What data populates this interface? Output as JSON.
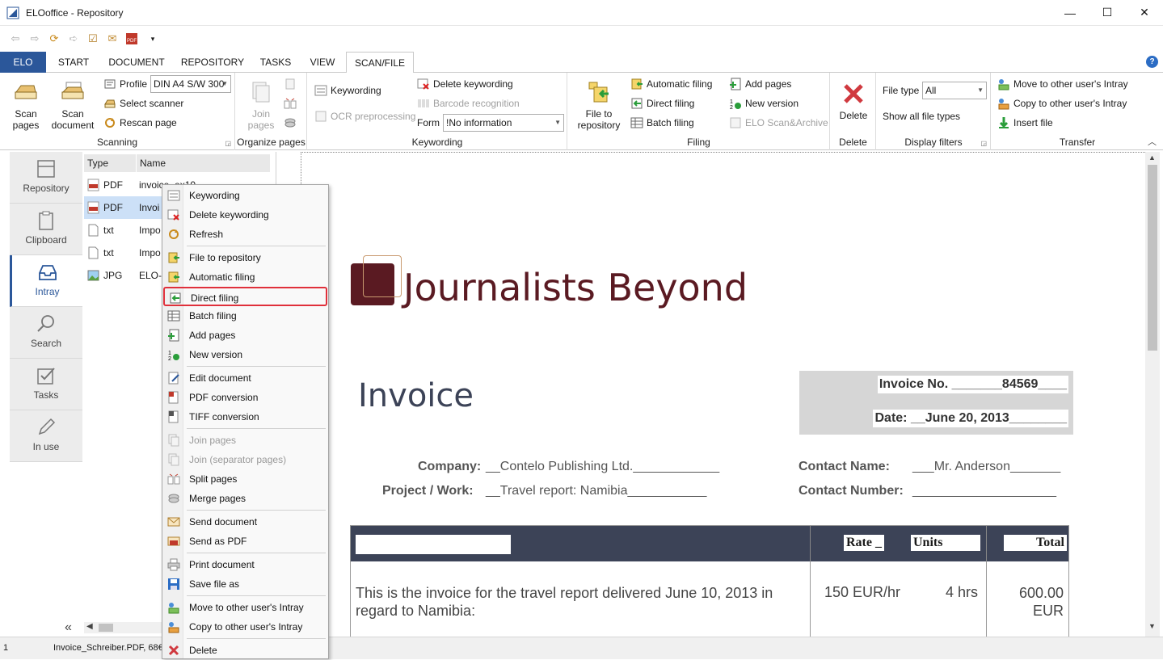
{
  "window": {
    "title": "ELOoffice  -  Repository",
    "min": "—",
    "max": "☐",
    "close": "✕"
  },
  "ribbon_tabs": [
    "ELO",
    "START",
    "DOCUMENT",
    "REPOSITORY",
    "TASKS",
    "VIEW",
    "SCAN/FILE"
  ],
  "scanning": {
    "scan_pages": "Scan pages",
    "scan_document": "Scan document",
    "profile_label": "Profile",
    "profile_value": "DIN A4 S/W 300",
    "select_scanner": "Select scanner",
    "rescan_page": "Rescan page",
    "group": "Scanning"
  },
  "organize": {
    "join_pages": "Join pages",
    "group": "Organize pages"
  },
  "keywording": {
    "keywording": "Keywording",
    "delete_keywording": "Delete keywording",
    "ocr": "OCR preprocessing",
    "barcode": "Barcode recognition",
    "form_label": "Form",
    "form_value": "!No information",
    "group": "Keywording"
  },
  "filing": {
    "file_to_repository": "File to repository",
    "automatic_filing": "Automatic filing",
    "direct_filing": "Direct filing",
    "batch_filing": "Batch filing",
    "add_pages": "Add pages",
    "new_version": "New version",
    "elo_scan": "ELO Scan&Archive",
    "group": "Filing"
  },
  "delete_group": {
    "delete": "Delete",
    "group": "Delete"
  },
  "display_filters": {
    "file_type_label": "File type",
    "file_type_value": "All",
    "show_all": "Show all file types",
    "group": "Display filters"
  },
  "transfer": {
    "move": "Move to other user's Intray",
    "copy": "Copy to other user's Intray",
    "insert": "Insert file",
    "group": "Transfer"
  },
  "nav": [
    "Repository",
    "Clipboard",
    "Intray",
    "Search",
    "Tasks",
    "In use"
  ],
  "filelist": {
    "headers": [
      "Type",
      "Name"
    ],
    "rows": [
      {
        "type": "PDF",
        "name": "invoice_ex10"
      },
      {
        "type": "PDF",
        "name": "Invoi"
      },
      {
        "type": "txt",
        "name": "Impo"
      },
      {
        "type": "txt",
        "name": "Impo"
      },
      {
        "type": "JPG",
        "name": "ELO-I"
      }
    ]
  },
  "context_menu": [
    "Keywording",
    "Delete keywording",
    "Refresh",
    "File to repository",
    "Automatic filing",
    "Direct filing",
    "Batch filing",
    "Add pages",
    "New version",
    "Edit document",
    "PDF conversion",
    "TIFF conversion",
    "Join pages",
    "Join (separator pages)",
    "Split pages",
    "Merge pages",
    "Send document",
    "Send as PDF",
    "Print document",
    "Save file as",
    "Move to other user's Intray",
    "Copy to other user's Intray",
    "Delete"
  ],
  "status": {
    "count": "1",
    "file": "Invoice_Schreiber.PDF, 68€"
  },
  "document": {
    "brand": "Journalists Beyond",
    "heading": "Invoice",
    "invoice_no": "Invoice No.   _______84569____",
    "date": "Date:  __June 20, 2013________",
    "company_label": "Company:",
    "company_value": "__Contelo Publishing Ltd.____________",
    "project_label": "Project / Work:",
    "project_value": "__Travel report: Namibia___________",
    "contact_name_label": "Contact Name:",
    "contact_name_value": "___Mr. Anderson_______",
    "contact_number_label": "Contact Number:",
    "contact_number_value": "____________________",
    "table_headers": [
      "Rate _",
      "Units",
      "Total"
    ],
    "row_text": "This is the invoice for the travel report delivered June 10, 2013 in regard to Namibia:",
    "row_rate": "150 EUR/hr",
    "row_units": "4 hrs",
    "row_total": "600.00 EUR"
  }
}
